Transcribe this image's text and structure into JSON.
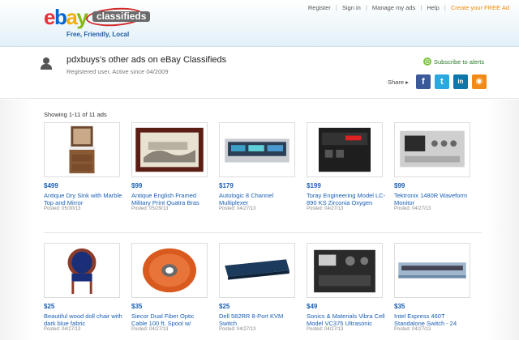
{
  "header": {
    "logo_brand": "ebay",
    "logo_product": "classifieds",
    "tagline": "Free, Friendly, Local",
    "nav": [
      {
        "label": "Register"
      },
      {
        "label": "Sign in"
      },
      {
        "label": "Manage my ads"
      },
      {
        "label": "Help"
      },
      {
        "label": "Create your FREE Ad"
      }
    ]
  },
  "profile": {
    "title": "pdxbuys's other ads on eBay Classifieds",
    "subtitle": "Registered user, Active since 04/2009",
    "subscribe_label": "Subscribe to alerts",
    "share_label": "Share",
    "share_icons": [
      "facebook-icon",
      "twitter-icon",
      "linkedin-icon",
      "rss-icon"
    ]
  },
  "listing": {
    "showing": "Showing 1-11 of 11 ads",
    "ads": [
      {
        "price": "$499",
        "title": "Antique Dry Sink with Marble Top and Mirror",
        "posted": "Posted: 05/30/13"
      },
      {
        "price": "$99",
        "title": "Antique English Framed Military Print Quatra Bras",
        "posted": "Posted: 05/29/13"
      },
      {
        "price": "$179",
        "title": "Autologic 8 Channel Multiplexer",
        "posted": "Posted: 04/27/13"
      },
      {
        "price": "$199",
        "title": "Toray Engineering Model LC-890 KS Zirconia Oxygen",
        "posted": "Posted: 04/27/13"
      },
      {
        "price": "$99",
        "title": "Tektronix 1480R Waveform Monitor",
        "posted": "Posted: 04/27/13"
      },
      {
        "price": "$25",
        "title": "Beautiful wood doll chair with dark blue fabric",
        "posted": "Posted: 04/27/13"
      },
      {
        "price": "$35",
        "title": "Siecor Dual Fiber Optic Cable 100 ft. Spool w/",
        "posted": "Posted: 04/27/13"
      },
      {
        "price": "$25",
        "title": "Dell 582RR 8-Port KVM Switch",
        "posted": "Posted: 04/27/13"
      },
      {
        "price": "$49",
        "title": "Sonics & Materials Vibra Cell Model VC375 Ultrasonic",
        "posted": "Posted: 04/27/13"
      },
      {
        "price": "$35",
        "title": "Intel Express 460T Standalone Switch - 24",
        "posted": "Posted: 04/27/13"
      }
    ]
  },
  "colors": {
    "link": "#1a5fb4",
    "create_ad": "#f08a00",
    "subscribe": "#2a7b2a"
  }
}
